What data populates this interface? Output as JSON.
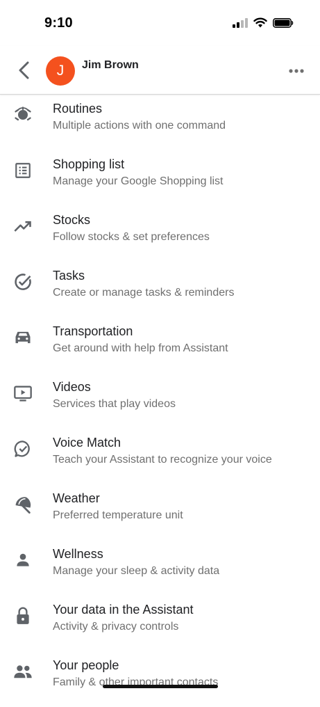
{
  "status_bar": {
    "time": "9:10"
  },
  "header": {
    "avatar_letter": "J",
    "user_name": "Jim Brown"
  },
  "colors": {
    "avatar": "#f4511e",
    "icon": "#5f6368",
    "subtitle": "#6f6f6f"
  },
  "items": [
    {
      "icon": "routines-icon",
      "title": "Routines",
      "subtitle": "Multiple actions with one command"
    },
    {
      "icon": "list-icon",
      "title": "Shopping list",
      "subtitle": "Manage your Google Shopping list"
    },
    {
      "icon": "trending-up-icon",
      "title": "Stocks",
      "subtitle": "Follow stocks & set preferences"
    },
    {
      "icon": "check-circle-icon",
      "title": "Tasks",
      "subtitle": "Create or manage tasks & reminders"
    },
    {
      "icon": "car-icon",
      "title": "Transportation",
      "subtitle": "Get around with help from Assistant"
    },
    {
      "icon": "tv-play-icon",
      "title": "Videos",
      "subtitle": "Services that play videos"
    },
    {
      "icon": "voice-check-icon",
      "title": "Voice Match",
      "subtitle": "Teach your Assistant to recognize your voice"
    },
    {
      "icon": "umbrella-icon",
      "title": "Weather",
      "subtitle": "Preferred temperature unit"
    },
    {
      "icon": "person-icon",
      "title": "Wellness",
      "subtitle": "Manage your sleep & activity data"
    },
    {
      "icon": "lock-icon",
      "title": "Your data in the Assistant",
      "subtitle": "Activity & privacy controls"
    },
    {
      "icon": "people-icon",
      "title": "Your people",
      "subtitle": "Family & other important contacts"
    }
  ]
}
